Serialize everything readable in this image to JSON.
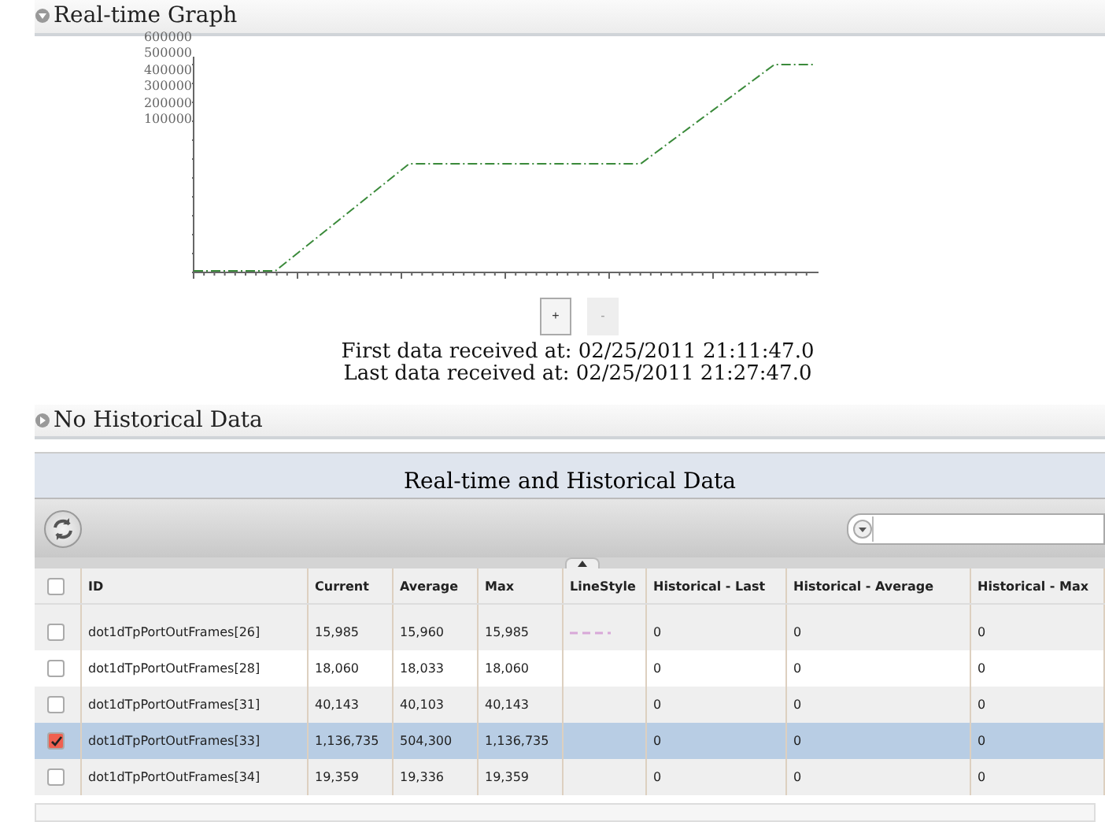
{
  "graph_section": {
    "title": "Real-time Graph",
    "expanded": true,
    "y_axis_labels": [
      "600000",
      "500000",
      "400000",
      "300000",
      "200000",
      "100000"
    ],
    "zoom_buttons": [
      "+",
      "-"
    ],
    "first_received": "First data received at: 02/25/2011 21:11:47.0",
    "last_received": "Last data received at: 02/25/2011 21:27:47.0"
  },
  "historical_section": {
    "title": "No Historical Data",
    "expanded": false
  },
  "panel": {
    "title": "Real-time and Historical Data",
    "table": {
      "all_checked": false,
      "columns": [
        "ID",
        "Current",
        "Average",
        "Max",
        "LineStyle",
        "Historical - Last",
        "Historical - Average",
        "Historical - Max"
      ],
      "rows": [
        {
          "checked": false,
          "selected": false,
          "cells": [
            "dot1dTpPortOutFrames[26]",
            "15,985",
            "15,960",
            "15,985",
            "",
            "0",
            "0",
            "0"
          ],
          "color": "#d8a8d8"
        },
        {
          "checked": false,
          "selected": false,
          "cells": [
            "dot1dTpPortOutFrames[28]",
            "18,060",
            "18,033",
            "18,060",
            "",
            "0",
            "0",
            "0"
          ]
        },
        {
          "checked": false,
          "selected": false,
          "cells": [
            "dot1dTpPortOutFrames[31]",
            "40,143",
            "40,103",
            "40,143",
            "",
            "0",
            "0",
            "0"
          ]
        },
        {
          "checked": true,
          "selected": true,
          "cells": [
            "dot1dTpPortOutFrames[33]",
            "1,136,735",
            "504,300",
            "1,136,735",
            "",
            "0",
            "0",
            "0"
          ]
        },
        {
          "checked": false,
          "selected": false,
          "cells": [
            "dot1dTpPortOutFrames[34]",
            "19,359",
            "19,336",
            "19,359",
            "",
            "0",
            "0",
            "0"
          ]
        }
      ]
    }
  }
}
